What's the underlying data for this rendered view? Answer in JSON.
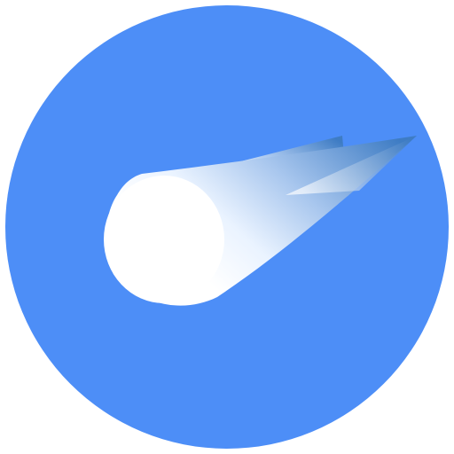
{
  "icon": {
    "name": "comet-logo",
    "colors": {
      "background_circle": "#4D8EF7",
      "comet_head": "#FFFFFF",
      "comet_tail_light": "#EAF3FF",
      "comet_tail_mid": "#A9C7EE",
      "comet_tail_dark": "#3E7CC4"
    }
  }
}
